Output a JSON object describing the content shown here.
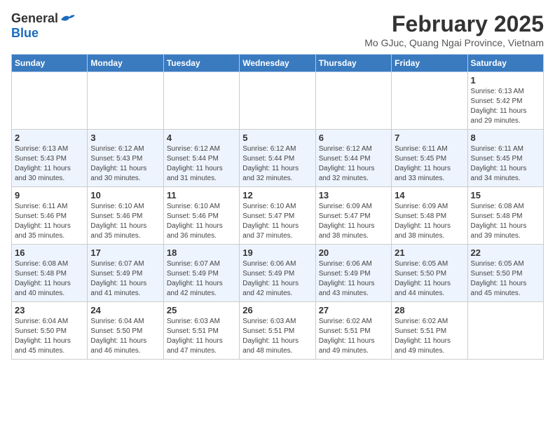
{
  "header": {
    "logo_general": "General",
    "logo_blue": "Blue",
    "month_year": "February 2025",
    "location": "Mo GJuc, Quang Ngai Province, Vietnam"
  },
  "days_of_week": [
    "Sunday",
    "Monday",
    "Tuesday",
    "Wednesday",
    "Thursday",
    "Friday",
    "Saturday"
  ],
  "weeks": [
    [
      {
        "day": "",
        "info": ""
      },
      {
        "day": "",
        "info": ""
      },
      {
        "day": "",
        "info": ""
      },
      {
        "day": "",
        "info": ""
      },
      {
        "day": "",
        "info": ""
      },
      {
        "day": "",
        "info": ""
      },
      {
        "day": "1",
        "info": "Sunrise: 6:13 AM\nSunset: 5:42 PM\nDaylight: 11 hours\nand 29 minutes."
      }
    ],
    [
      {
        "day": "2",
        "info": "Sunrise: 6:13 AM\nSunset: 5:43 PM\nDaylight: 11 hours\nand 30 minutes."
      },
      {
        "day": "3",
        "info": "Sunrise: 6:12 AM\nSunset: 5:43 PM\nDaylight: 11 hours\nand 30 minutes."
      },
      {
        "day": "4",
        "info": "Sunrise: 6:12 AM\nSunset: 5:44 PM\nDaylight: 11 hours\nand 31 minutes."
      },
      {
        "day": "5",
        "info": "Sunrise: 6:12 AM\nSunset: 5:44 PM\nDaylight: 11 hours\nand 32 minutes."
      },
      {
        "day": "6",
        "info": "Sunrise: 6:12 AM\nSunset: 5:44 PM\nDaylight: 11 hours\nand 32 minutes."
      },
      {
        "day": "7",
        "info": "Sunrise: 6:11 AM\nSunset: 5:45 PM\nDaylight: 11 hours\nand 33 minutes."
      },
      {
        "day": "8",
        "info": "Sunrise: 6:11 AM\nSunset: 5:45 PM\nDaylight: 11 hours\nand 34 minutes."
      }
    ],
    [
      {
        "day": "9",
        "info": "Sunrise: 6:11 AM\nSunset: 5:46 PM\nDaylight: 11 hours\nand 35 minutes."
      },
      {
        "day": "10",
        "info": "Sunrise: 6:10 AM\nSunset: 5:46 PM\nDaylight: 11 hours\nand 35 minutes."
      },
      {
        "day": "11",
        "info": "Sunrise: 6:10 AM\nSunset: 5:46 PM\nDaylight: 11 hours\nand 36 minutes."
      },
      {
        "day": "12",
        "info": "Sunrise: 6:10 AM\nSunset: 5:47 PM\nDaylight: 11 hours\nand 37 minutes."
      },
      {
        "day": "13",
        "info": "Sunrise: 6:09 AM\nSunset: 5:47 PM\nDaylight: 11 hours\nand 38 minutes."
      },
      {
        "day": "14",
        "info": "Sunrise: 6:09 AM\nSunset: 5:48 PM\nDaylight: 11 hours\nand 38 minutes."
      },
      {
        "day": "15",
        "info": "Sunrise: 6:08 AM\nSunset: 5:48 PM\nDaylight: 11 hours\nand 39 minutes."
      }
    ],
    [
      {
        "day": "16",
        "info": "Sunrise: 6:08 AM\nSunset: 5:48 PM\nDaylight: 11 hours\nand 40 minutes."
      },
      {
        "day": "17",
        "info": "Sunrise: 6:07 AM\nSunset: 5:49 PM\nDaylight: 11 hours\nand 41 minutes."
      },
      {
        "day": "18",
        "info": "Sunrise: 6:07 AM\nSunset: 5:49 PM\nDaylight: 11 hours\nand 42 minutes."
      },
      {
        "day": "19",
        "info": "Sunrise: 6:06 AM\nSunset: 5:49 PM\nDaylight: 11 hours\nand 42 minutes."
      },
      {
        "day": "20",
        "info": "Sunrise: 6:06 AM\nSunset: 5:49 PM\nDaylight: 11 hours\nand 43 minutes."
      },
      {
        "day": "21",
        "info": "Sunrise: 6:05 AM\nSunset: 5:50 PM\nDaylight: 11 hours\nand 44 minutes."
      },
      {
        "day": "22",
        "info": "Sunrise: 6:05 AM\nSunset: 5:50 PM\nDaylight: 11 hours\nand 45 minutes."
      }
    ],
    [
      {
        "day": "23",
        "info": "Sunrise: 6:04 AM\nSunset: 5:50 PM\nDaylight: 11 hours\nand 45 minutes."
      },
      {
        "day": "24",
        "info": "Sunrise: 6:04 AM\nSunset: 5:50 PM\nDaylight: 11 hours\nand 46 minutes."
      },
      {
        "day": "25",
        "info": "Sunrise: 6:03 AM\nSunset: 5:51 PM\nDaylight: 11 hours\nand 47 minutes."
      },
      {
        "day": "26",
        "info": "Sunrise: 6:03 AM\nSunset: 5:51 PM\nDaylight: 11 hours\nand 48 minutes."
      },
      {
        "day": "27",
        "info": "Sunrise: 6:02 AM\nSunset: 5:51 PM\nDaylight: 11 hours\nand 49 minutes."
      },
      {
        "day": "28",
        "info": "Sunrise: 6:02 AM\nSunset: 5:51 PM\nDaylight: 11 hours\nand 49 minutes."
      },
      {
        "day": "",
        "info": ""
      }
    ]
  ]
}
